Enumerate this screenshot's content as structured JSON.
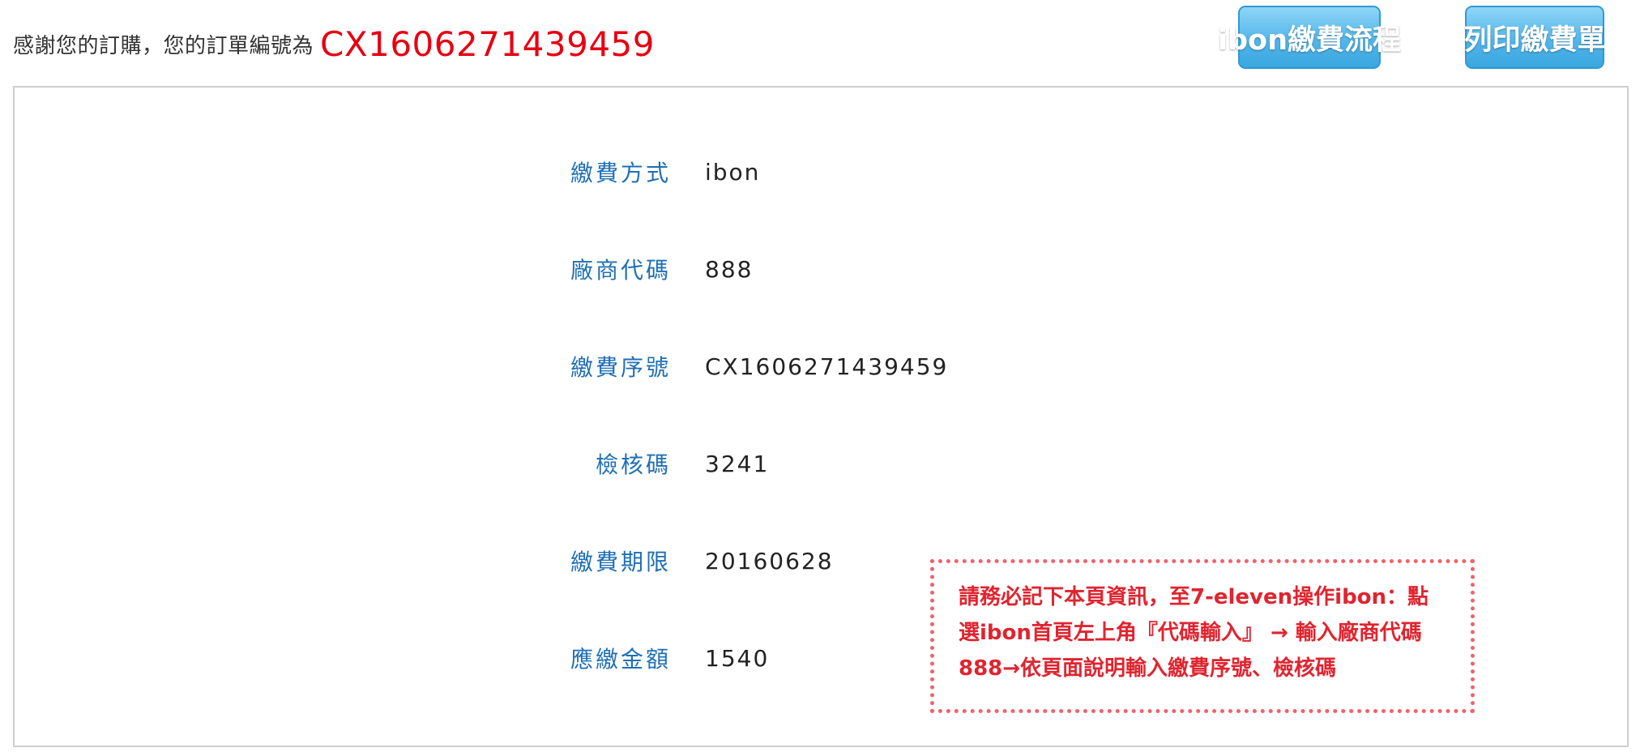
{
  "header": {
    "thanks_text": "感謝您的訂購，您的訂單編號為",
    "order_number": "CX1606271439459"
  },
  "buttons": {
    "ibon_flow": "ibon繳費流程",
    "print_slip": "列印繳費單"
  },
  "payment_info": {
    "rows": [
      {
        "label": "繳費方式",
        "value": "ibon"
      },
      {
        "label": "廠商代碼",
        "value": "888"
      },
      {
        "label": "繳費序號",
        "value": "CX1606271439459"
      },
      {
        "label": "檢核碼",
        "value": "3241"
      },
      {
        "label": "繳費期限",
        "value": "20160628"
      },
      {
        "label": "應繳金額",
        "value": "1540"
      }
    ]
  },
  "notice": {
    "text": "請務必記下本頁資訊，至7-eleven操作ibon：點選ibon首頁左上角『代碼輸入』 → 輸入廠商代碼888→依頁面說明輸入繳費序號、檢核碼"
  },
  "colors": {
    "order_number": "#e60012",
    "label": "#1f6fb5",
    "button": "#52b6ea",
    "notice_border": "#f0626b",
    "notice_text": "#e0242f"
  }
}
